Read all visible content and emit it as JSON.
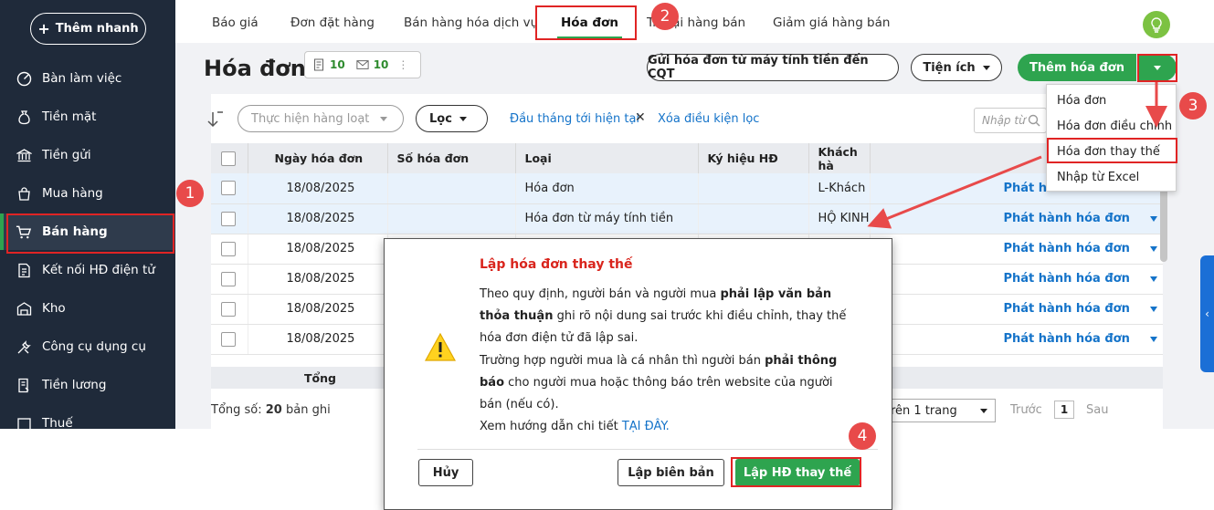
{
  "sidebar": {
    "quick_add": "Thêm nhanh",
    "items": [
      {
        "label": "Bàn làm việc",
        "icon": "dashboard-icon"
      },
      {
        "label": "Tiền mặt",
        "icon": "money-bag-icon"
      },
      {
        "label": "Tiền gửi",
        "icon": "bank-icon"
      },
      {
        "label": "Mua hàng",
        "icon": "shopping-bag-icon"
      },
      {
        "label": "Bán hàng",
        "icon": "cart-icon"
      },
      {
        "label": "Kết nối HĐ điện tử",
        "icon": "e-invoice-icon"
      },
      {
        "label": "Kho",
        "icon": "warehouse-icon"
      },
      {
        "label": "Công cụ dụng cụ",
        "icon": "tools-icon"
      },
      {
        "label": "Tiền lương",
        "icon": "payroll-icon"
      },
      {
        "label": "Thuế",
        "icon": "tax-icon"
      }
    ]
  },
  "tabs": [
    "Báo giá",
    "Đơn đặt hàng",
    "Bán hàng hóa dịch vụ",
    "Hóa đơn",
    "Trả lại hàng bán",
    "Giảm giá hàng bán"
  ],
  "header": {
    "title": "Hóa đơn",
    "counter_a": "10",
    "counter_b": "10",
    "send_btn": "Gửi hóa đơn từ máy tính tiền đến CQT",
    "utility_btn": "Tiện ích",
    "add_btn": "Thêm hóa đơn"
  },
  "dropdown": [
    "Hóa đơn",
    "Hóa đơn điều chỉnh",
    "Hóa đơn thay thế",
    "Nhập từ Excel"
  ],
  "toolbar": {
    "bulk": "Thực hiện hàng loạt",
    "filter": "Lọc",
    "period": "Đầu tháng tới hiện tại",
    "clear_filter": "Xóa điều kiện lọc",
    "search_placeholder": "Nhập từ"
  },
  "table": {
    "columns": [
      "Ngày hóa đơn",
      "Số hóa đơn",
      "Loại",
      "Ký hiệu HĐ",
      "Khách hà"
    ],
    "action_label": "Phát hành hóa đơn",
    "rows": [
      {
        "date": "18/08/2025",
        "no": "",
        "type": "Hóa đơn",
        "symbol": "",
        "customer": "L-Khách",
        "action": "Phát hành hóa đơn"
      },
      {
        "date": "18/08/2025",
        "no": "",
        "type": "Hóa đơn từ máy tính tiền",
        "symbol": "",
        "customer": "HỘ KINH",
        "action": "Phát hành hóa đơn"
      },
      {
        "date": "18/08/2025",
        "no": "",
        "type": "",
        "symbol": "",
        "customer": "",
        "action": "Phát hành hóa đơn"
      },
      {
        "date": "18/08/2025",
        "no": "",
        "type": "",
        "symbol": "",
        "customer": "",
        "action": "Phát hành hóa đơn"
      },
      {
        "date": "18/08/2025",
        "no": "",
        "type": "",
        "symbol": "",
        "customer": "",
        "action": "Phát hành hóa đơn"
      },
      {
        "date": "18/08/2025",
        "no": "",
        "type": "",
        "symbol": "",
        "customer": "",
        "action": "Phát hành hóa đơn"
      }
    ],
    "total_label": "Tổng"
  },
  "footer": {
    "total_prefix": "Tổng số: ",
    "total_count": "20",
    "total_suffix": " bản ghi",
    "per_page": "rên 1 trang",
    "prev": "Trước",
    "page": "1",
    "next": "Sau"
  },
  "modal": {
    "title": "Lập hóa đơn thay thế",
    "p1_a": "Theo quy định, người bán và người mua ",
    "p1_b": "phải lập văn bản thỏa thuận",
    "p1_c": " ghi rõ nội dung sai trước khi điều chỉnh, thay thế hóa đơn điện tử đã lập sai.",
    "p2_a": "Trường hợp người mua là cá nhân thì người bán ",
    "p2_b": "phải thông báo",
    "p2_c": " cho người mua hoặc thông báo trên website của người bán (nếu có).",
    "p3_a": "Xem hướng dẫn chi tiết ",
    "p3_link": "TẠI ĐÂY.",
    "cancel": "Hủy",
    "record": "Lập biên bản",
    "confirm": "Lập HĐ thay thế"
  },
  "badges": [
    "1",
    "2",
    "3",
    "4"
  ],
  "colors": {
    "primary": "#2ea44f",
    "sidebar": "#1f2a3a",
    "link": "#1473c9",
    "alert": "#d9251d",
    "annotation": "#e02424"
  }
}
